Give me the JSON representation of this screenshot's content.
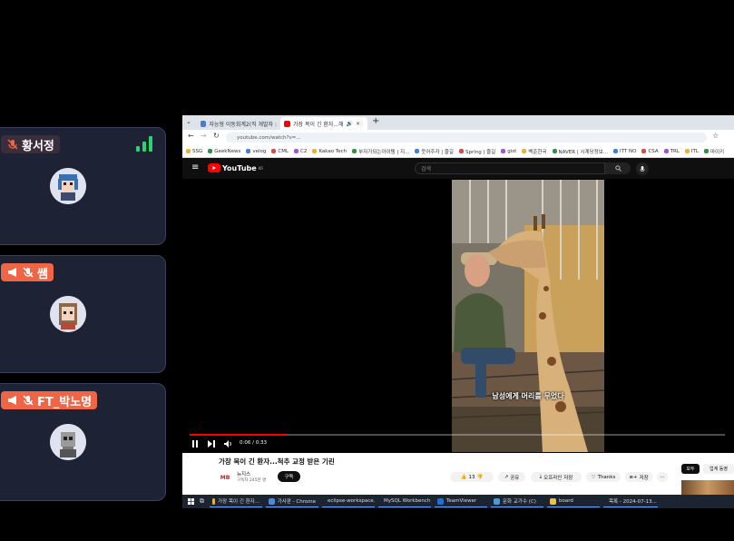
{
  "participants": [
    {
      "name": "황서정",
      "muted": true,
      "megaphone": false
    },
    {
      "name": "쌤",
      "muted": true,
      "megaphone": true
    },
    {
      "name": "FT_박노명",
      "muted": true,
      "megaphone": true
    }
  ],
  "browser": {
    "tabs": [
      {
        "label": "자능형 이동회계2(직 개발자 :"
      },
      {
        "label": "가장 목이 긴 환자...해"
      }
    ],
    "new_tab": "+",
    "url": "youtube.com/watch?v=...",
    "bookmarks": [
      "SSG",
      "GeekNews",
      "velog",
      "CML",
      "C2",
      "Kakao Tech",
      "부자가되는아이템 | 지...",
      "웃어주자 | 즐길",
      "Spring | 즐길",
      "gist",
      "백준한국",
      "NAVER | 시계당정보...",
      "ITT NO",
      "CSA",
      "TRL",
      "ITL",
      "마이키"
    ]
  },
  "youtube": {
    "logo": "YouTube",
    "logo_sup": "KR",
    "search_placeholder": "검색",
    "subtitle": "남성에게 머리를 무었다",
    "time": "0:06 / 0:33",
    "progress": 0.18,
    "title": "가장 목이 긴 환자...척추 교정 받은 기린",
    "channel_logo": "MB",
    "channel_name": "뉴지스",
    "subscribers": "구독자 245천 명",
    "subscribe_label": "구독",
    "likes": "13",
    "share": "공유",
    "download": "오프라인 저장",
    "thanks": "Thanks",
    "save": "저장",
    "more": "···",
    "chip_all": "모두",
    "chip_other": "업계 동영"
  },
  "taskbar": {
    "items": [
      "가장 목이 긴 환자...",
      "가사판 - Chrome",
      "eclipse-workspace...",
      "MySQL Workbench",
      "TeamViewer",
      "문화 교가수 (C)",
      "board",
      "목록 - 2024-07-13..."
    ]
  },
  "colors": {
    "accent_orange": "#ee6645",
    "signal_green": "#2dd36f",
    "yt_red": "#ff0000",
    "card_bg": "#1e2235"
  }
}
